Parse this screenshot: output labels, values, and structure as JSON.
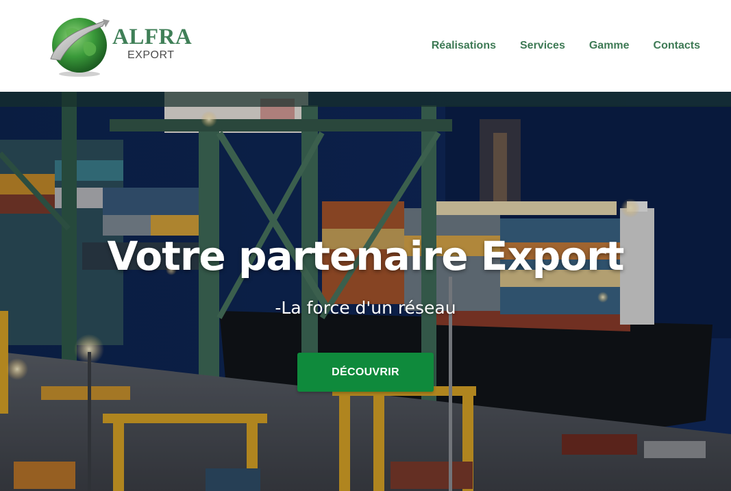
{
  "brand": {
    "name": "ALFRA",
    "tagline": "EXPORT",
    "logo_icon": "globe-arrow-icon",
    "primary_color": "#3f7f57"
  },
  "nav": {
    "items": [
      {
        "label": "Réalisations"
      },
      {
        "label": "Services"
      },
      {
        "label": "Gamme"
      },
      {
        "label": "Contacts"
      }
    ]
  },
  "hero": {
    "title": "Votre partenaire Export",
    "subtitle": "-La force d'un réseau",
    "cta_label": "DÉCOUVRIR",
    "cta_color": "#0f8a3c",
    "image_description_icon": "port-container-ship-image"
  }
}
